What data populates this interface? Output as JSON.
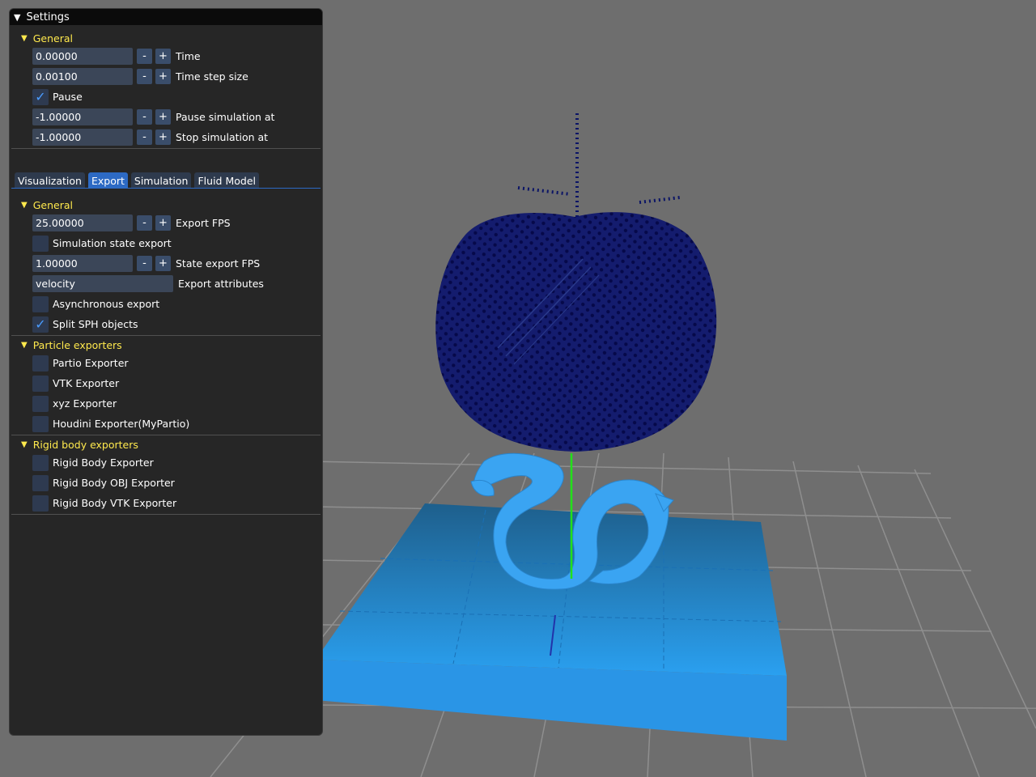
{
  "window": {
    "title": "Settings"
  },
  "general": {
    "header": "General",
    "time": {
      "value": "0.00000",
      "label": "Time"
    },
    "time_step": {
      "value": "0.00100",
      "label": "Time step size"
    },
    "pause": {
      "label": "Pause",
      "checked": true
    },
    "pause_at": {
      "value": "-1.00000",
      "label": "Pause simulation at"
    },
    "stop_at": {
      "value": "-1.00000",
      "label": "Stop simulation at"
    }
  },
  "buttons": {
    "minus": "-",
    "plus": "+"
  },
  "tabs": [
    {
      "label": "Visualization",
      "active": false
    },
    {
      "label": "Export",
      "active": true
    },
    {
      "label": "Simulation",
      "active": false
    },
    {
      "label": "Fluid Model",
      "active": false
    }
  ],
  "export": {
    "general_header": "General",
    "export_fps": {
      "value": "25.00000",
      "label": "Export FPS"
    },
    "state_export": {
      "label": "Simulation state export",
      "checked": false
    },
    "state_fps": {
      "value": "1.00000",
      "label": "State export FPS"
    },
    "attributes": {
      "value": "velocity",
      "label": "Export attributes"
    },
    "async": {
      "label": "Asynchronous export",
      "checked": false
    },
    "split_sph": {
      "label": "Split SPH objects",
      "checked": true
    },
    "particle_header": "Particle exporters",
    "particle_exporters": [
      {
        "label": "Partio Exporter",
        "checked": false
      },
      {
        "label": "VTK Exporter",
        "checked": false
      },
      {
        "label": "xyz Exporter",
        "checked": false
      },
      {
        "label": "Houdini Exporter(MyPartio)",
        "checked": false
      }
    ],
    "rigid_header": "Rigid body exporters",
    "rigid_exporters": [
      {
        "label": "Rigid Body Exporter",
        "checked": false
      },
      {
        "label": "Rigid Body OBJ Exporter",
        "checked": false
      },
      {
        "label": "Rigid Body VTK Exporter",
        "checked": false
      }
    ]
  },
  "colors": {
    "background": "#6e6e6e",
    "panel": "#262626",
    "header_text": "#ffe94d",
    "accent": "#2d6ac4",
    "fluid": "#0b1466",
    "rigid": "#2a95e6",
    "axis": "#22e01a"
  }
}
